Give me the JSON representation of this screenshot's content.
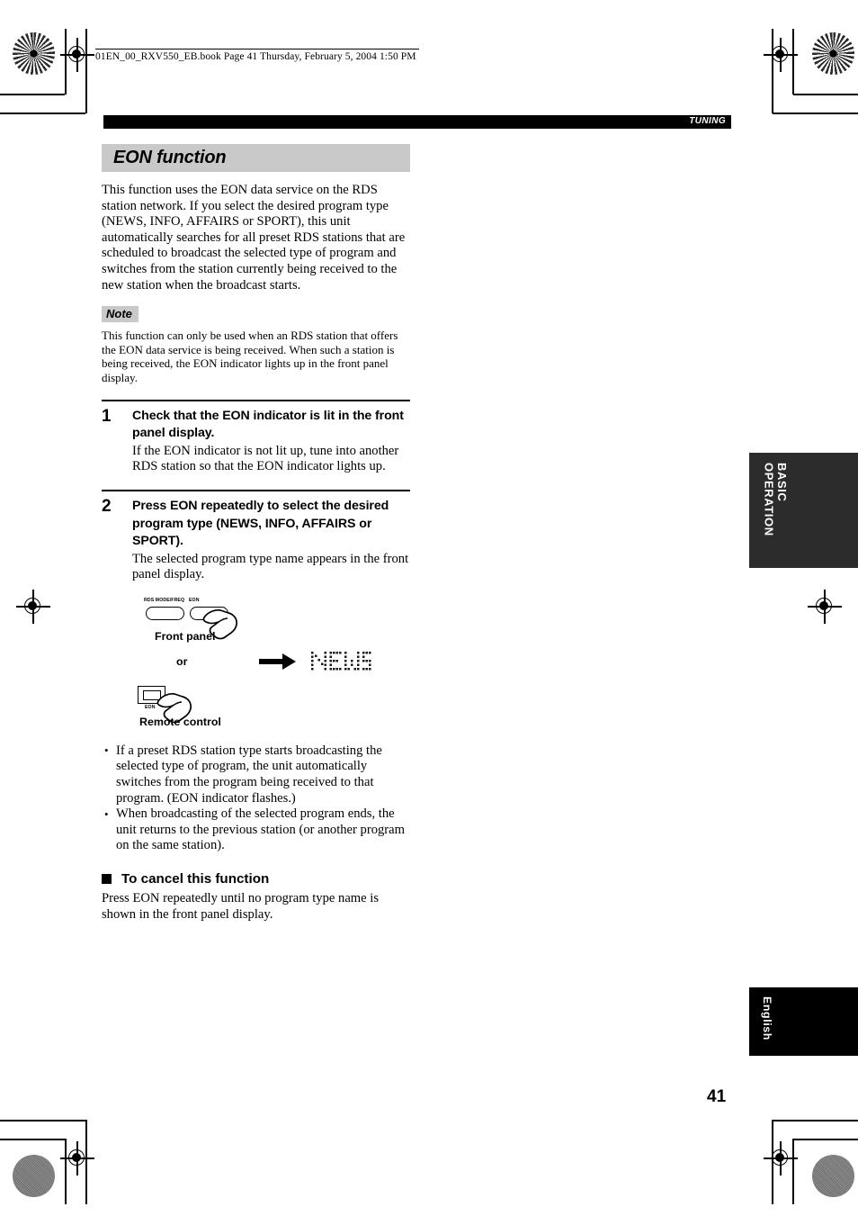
{
  "print_header": {
    "file_line": "01EN_00_RXV550_EB.book  Page 41  Thursday, February 5, 2004  1:50 PM"
  },
  "running_head": {
    "label": "TUNING"
  },
  "section": {
    "title": "EON function",
    "intro": "This function uses the EON data service on the RDS station network. If you select the desired program type (NEWS, INFO, AFFAIRS or SPORT), this unit automatically searches for all preset RDS stations that are scheduled to broadcast the selected type of program and switches from the station currently being received to the new station when the broadcast starts."
  },
  "note": {
    "label": "Note",
    "text": "This function can only be used when an RDS station that offers the EON data service is being received. When such a station is being received, the EON indicator lights up in the front panel display."
  },
  "steps": [
    {
      "number": "1",
      "heading": "Check that the EON indicator is lit in the front panel display.",
      "body": "If the EON indicator is not lit up, tune into another RDS station so that the EON indicator lights up."
    },
    {
      "number": "2",
      "heading": "Press EON repeatedly to select the desired program type (NEWS, INFO, AFFAIRS or SPORT).",
      "body": "The selected program type name appears in the front panel display."
    }
  ],
  "illustration": {
    "front_panel_button_left_label": "RDS MODE/FREQ",
    "front_panel_button_right_label": "EON",
    "front_panel_caption": "Front panel",
    "or_label": "or",
    "display_text": "NEWS",
    "remote_button_label": "EON",
    "remote_caption": "Remote control"
  },
  "bullets": [
    "If a preset RDS station type starts broadcasting the selected type of program, the unit automatically switches from the program being received to that program. (EON indicator flashes.)",
    "When broadcasting of the selected program ends, the unit returns to the previous station (or another program on the same station)."
  ],
  "cancel_section": {
    "heading": "To cancel this function",
    "body": "Press EON repeatedly until no program type name is shown in the front panel display."
  },
  "side_tabs": {
    "basic_operation": "BASIC\nOPERATION",
    "language": "English"
  },
  "page_number": "41",
  "colors": {
    "section_band": "#c9c9c9",
    "running_head_bar": "#000000",
    "tab_basic_bg": "#2c2c2c",
    "tab_language_bg": "#000000"
  }
}
